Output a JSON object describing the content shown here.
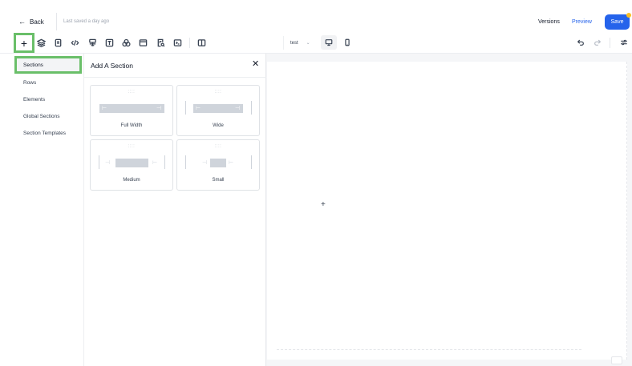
{
  "header": {
    "back_label": "Back",
    "saved_text": "Last saved a day ago",
    "versions_label": "Versions",
    "preview_label": "Preview",
    "save_label": "Save"
  },
  "toolbar": {
    "add_symbol": "+",
    "page_selector_value": "test",
    "icons": [
      "add-element-icon",
      "layers-icon",
      "pages-icon",
      "code-icon",
      "form-icon",
      "text-icon",
      "colors-icon",
      "layout-icon",
      "search-file-icon",
      "terminal-icon",
      "columns-icon",
      "desktop-icon",
      "mobile-icon",
      "undo-icon",
      "redo-icon",
      "settings-icon"
    ]
  },
  "sidebar": {
    "items": [
      {
        "label": "Sections",
        "active": true
      },
      {
        "label": "Rows",
        "active": false
      },
      {
        "label": "Elements",
        "active": false
      },
      {
        "label": "Global Sections",
        "active": false
      },
      {
        "label": "Section Templates",
        "active": false
      }
    ]
  },
  "panel": {
    "title": "Add A Section",
    "close_symbol": "✕",
    "grip": "::::",
    "cards": [
      {
        "label": "Full Width"
      },
      {
        "label": "Wide"
      },
      {
        "label": "Medium"
      },
      {
        "label": "Small"
      }
    ]
  },
  "canvas": {
    "add_symbol": "+"
  },
  "colors": {
    "accent": "#2563eb",
    "highlight_border": "#6abf69",
    "notification_dot": "#fbbf24"
  }
}
